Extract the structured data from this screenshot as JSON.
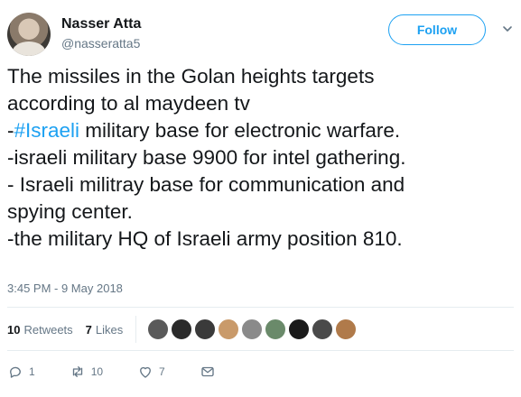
{
  "user": {
    "name": "Nasser Atta",
    "handle": "@nasseratta5"
  },
  "follow_label": "Follow",
  "tweet": {
    "lines": [
      {
        "text": "The missiles in the Golan heights targets"
      },
      {
        "text": "according to al maydeen tv"
      },
      {
        "prefix": "-",
        "hashtag": "#Israeli",
        "rest": " military base for electronic warfare."
      },
      {
        "text": "-israeli military base 9900 for intel gathering."
      },
      {
        "text": "- Israeli militray base for communication and"
      },
      {
        "text": "spying center."
      },
      {
        "text": "-the military HQ of Israeli army position 810."
      }
    ]
  },
  "timestamp": "3:45 PM - 9 May 2018",
  "stats": {
    "retweets_count": "10",
    "retweets_label": "Retweets",
    "likes_count": "7",
    "likes_label": "Likes"
  },
  "liker_avatars": [
    "#5a5a5a",
    "#2b2b2b",
    "#3a3a3a",
    "#c99a6a",
    "#8a8a8a",
    "#6a8a6a",
    "#1a1a1a",
    "#4a4a4a",
    "#b07a4a"
  ],
  "actions": {
    "reply_count": "1",
    "retweet_count": "10",
    "like_count": "7"
  },
  "colors": {
    "accent": "#1da1f2",
    "text": "#14171a",
    "muted": "#657786",
    "divider": "#e6ecf0"
  },
  "icons": [
    "chevron-down-icon",
    "reply-icon",
    "retweet-icon",
    "like-icon",
    "direct-message-icon"
  ]
}
